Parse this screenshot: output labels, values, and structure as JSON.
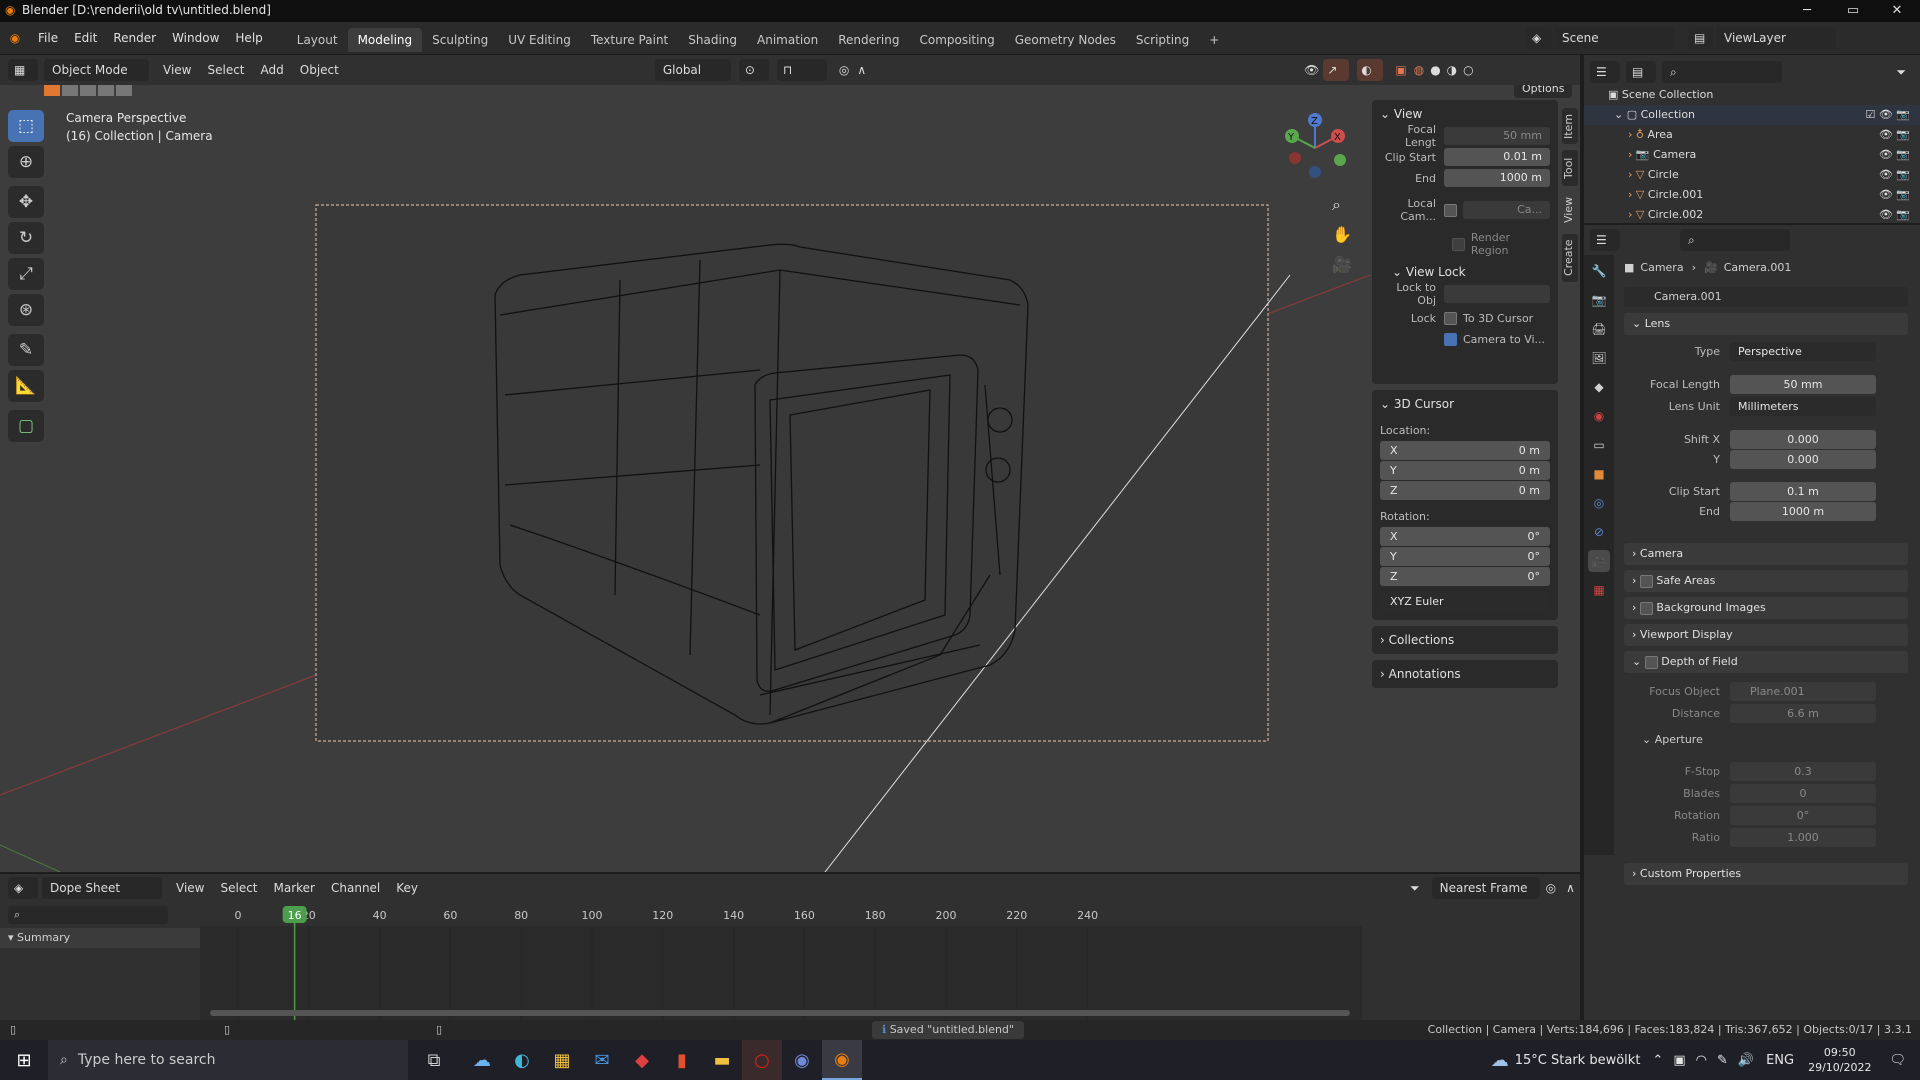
{
  "titlebar": {
    "title": "Blender [D:\\renderii\\old tv\\untitled.blend]",
    "minimize": "─",
    "maximize": "▭",
    "close": "✕"
  },
  "menubar": {
    "items": [
      "File",
      "Edit",
      "Render",
      "Window",
      "Help"
    ],
    "tabs": [
      "Layout",
      "Modeling",
      "Sculpting",
      "UV Editing",
      "Texture Paint",
      "Shading",
      "Animation",
      "Rendering",
      "Compositing",
      "Geometry Nodes",
      "Scripting"
    ],
    "active_tab": "Modeling",
    "add_tab": "+",
    "scene": "Scene",
    "viewlayer": "ViewLayer"
  },
  "viewport": {
    "mode": "Object Mode",
    "menus": [
      "View",
      "Select",
      "Add",
      "Object"
    ],
    "orientation": "Global",
    "options": "Options",
    "overlay_title": "Camera Perspective",
    "overlay_sub": "(16) Collection | Camera"
  },
  "npanel": {
    "view_title": "View",
    "focal_label": "Focal Lengt",
    "focal_value": "50 mm",
    "clip_start_label": "Clip Start",
    "clip_start_value": "0.01 m",
    "clip_end_label": "End",
    "clip_end_value": "1000 m",
    "local_cam_label": "Local Cam...",
    "local_cam_value": "Ca...",
    "render_region": "Render Region",
    "view_lock_title": "View Lock",
    "lock_obj_label": "Lock to Obj",
    "lock_label": "Lock",
    "to_cursor": "To 3D Cursor",
    "camera_to_view": "Camera to Vi...",
    "cursor_title": "3D Cursor",
    "location_label": "Location:",
    "loc": [
      {
        "axis": "X",
        "value": "0 m"
      },
      {
        "axis": "Y",
        "value": "0 m"
      },
      {
        "axis": "Z",
        "value": "0 m"
      }
    ],
    "rotation_label": "Rotation:",
    "rot": [
      {
        "axis": "X",
        "value": "0°"
      },
      {
        "axis": "Y",
        "value": "0°"
      },
      {
        "axis": "Z",
        "value": "0°"
      }
    ],
    "rot_mode": "XYZ Euler",
    "collections": "Collections",
    "annotations": "Annotations",
    "tabs": [
      "Item",
      "Tool",
      "View",
      "Create"
    ]
  },
  "outliner": {
    "scene_collection": "Scene Collection",
    "collection": "Collection",
    "items": [
      "Area",
      "Camera",
      "Circle",
      "Circle.001",
      "Circle.002"
    ]
  },
  "props": {
    "breadcrumb_obj": "Camera",
    "breadcrumb_data": "Camera.001",
    "datablock": "Camera.001",
    "lens": "Lens",
    "type_label": "Type",
    "type_value": "Perspective",
    "focal_label": "Focal Length",
    "focal_value": "50 mm",
    "lens_unit_label": "Lens Unit",
    "lens_unit_value": "Millimeters",
    "shiftx_label": "Shift X",
    "shiftx_value": "0.000",
    "shifty_label": "Y",
    "shifty_value": "0.000",
    "clip_start_label": "Clip Start",
    "clip_start_value": "0.1 m",
    "clip_end_label": "End",
    "clip_end_value": "1000 m",
    "camera": "Camera",
    "safe_areas": "Safe Areas",
    "bg_images": "Background Images",
    "viewport_display": "Viewport Display",
    "dof": "Depth of Field",
    "focus_label": "Focus Object",
    "focus_value": "Plane.001",
    "distance_label": "Distance",
    "distance_value": "6.6 m",
    "aperture": "Aperture",
    "fstop_label": "F-Stop",
    "fstop_value": "0.3",
    "blades_label": "Blades",
    "blades_value": "0",
    "rotation_label": "Rotation",
    "rotation_value": "0°",
    "ratio_label": "Ratio",
    "ratio_value": "1.000",
    "custom_props": "Custom Properties"
  },
  "dope": {
    "editor": "Dope Sheet",
    "menus": [
      "View",
      "Select",
      "Marker",
      "Channel",
      "Key"
    ],
    "snap": "Nearest Frame",
    "summary": "Summary",
    "current_frame": "16",
    "current_frame_value": 16,
    "ticks": [
      0,
      20,
      40,
      60,
      80,
      100,
      120,
      140,
      160,
      180,
      200,
      220,
      240
    ]
  },
  "status": {
    "message": "Saved \"untitled.blend\"",
    "stats": "Collection | Camera | Verts:184,696 | Faces:183,824 | Tris:367,652 | Objects:0/17 | 3.3.1"
  },
  "taskbar": {
    "search": "Type here to search",
    "weather": "15°C  Stark bewölkt",
    "lang": "ENG",
    "time": "09:50",
    "date": "29/10/2022"
  }
}
